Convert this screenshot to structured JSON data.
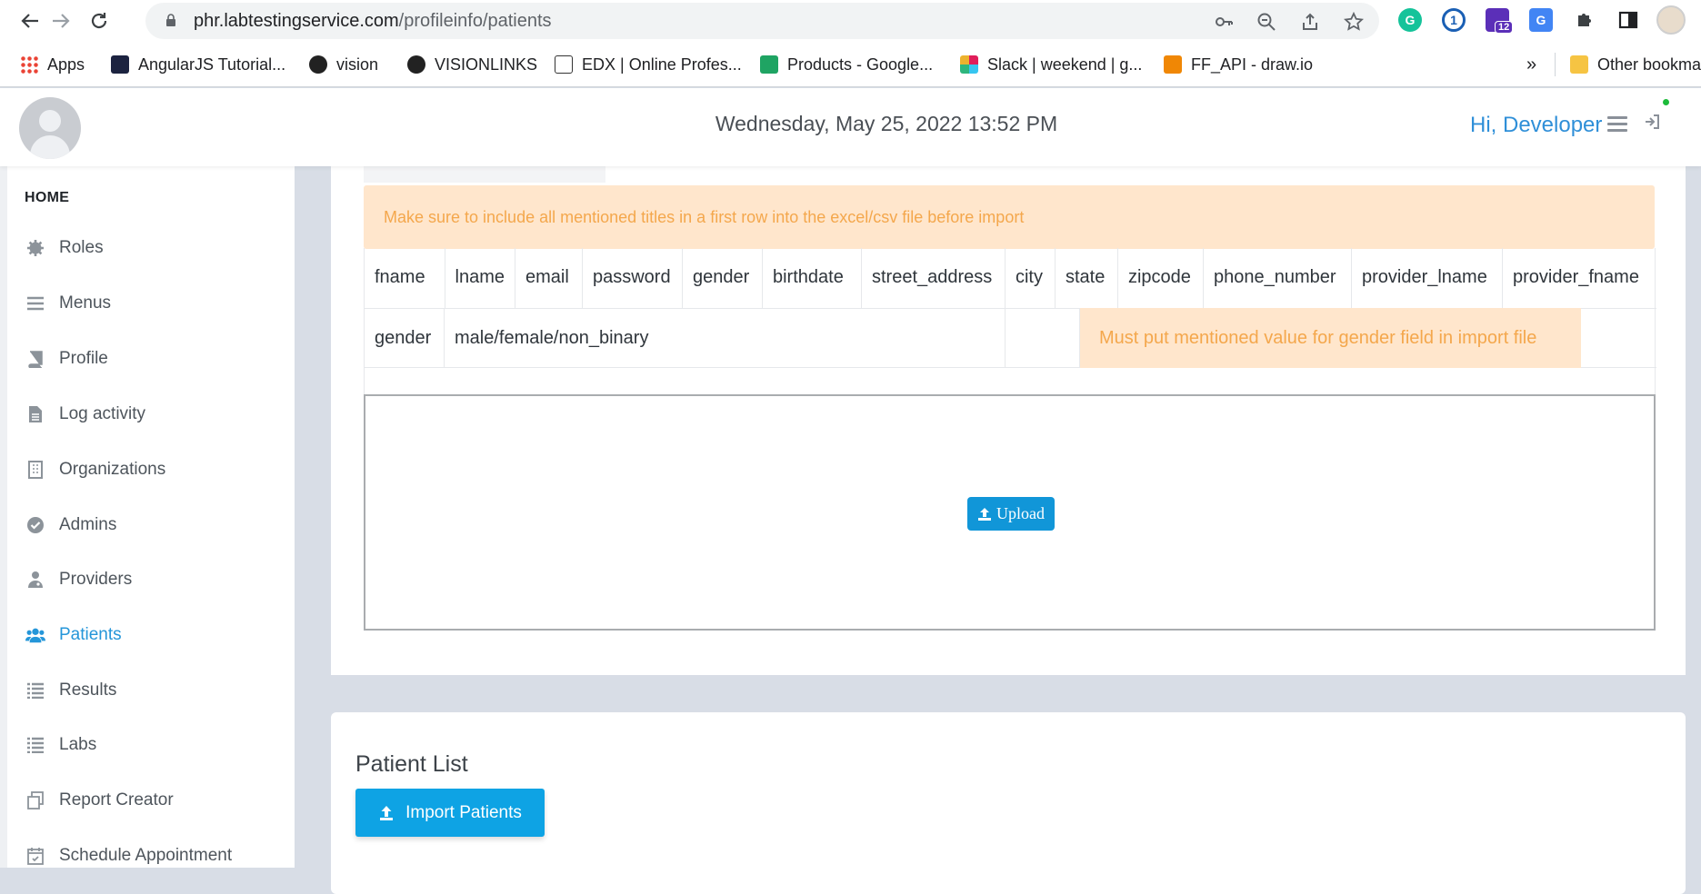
{
  "browser": {
    "url_host": "phr.labtestingservice.com",
    "url_path": "/profileinfo/patients",
    "extension_badge": "12",
    "bookmarks": [
      {
        "label": "Apps"
      },
      {
        "label": "AngularJS Tutorial..."
      },
      {
        "label": "vision"
      },
      {
        "label": "VISIONLINKS"
      },
      {
        "label": "EDX | Online Profes..."
      },
      {
        "label": "Products - Google..."
      },
      {
        "label": "Slack | weekend | g..."
      },
      {
        "label": "FF_API - draw.io"
      }
    ],
    "more_bookmarks": "»",
    "other_bookmarks": "Other bookmarks"
  },
  "header": {
    "datetime": "Wednesday, May 25, 2022 13:52 PM",
    "greeting": "Hi, Developer"
  },
  "sidebar": {
    "heading": "HOME",
    "items": [
      {
        "label": "Roles",
        "icon": "gear-icon"
      },
      {
        "label": "Menus",
        "icon": "menu-icon"
      },
      {
        "label": "Profile",
        "icon": "book-icon"
      },
      {
        "label": "Log activity",
        "icon": "file-icon"
      },
      {
        "label": "Organizations",
        "icon": "building-icon"
      },
      {
        "label": "Admins",
        "icon": "check-circle-icon"
      },
      {
        "label": "Providers",
        "icon": "doctor-icon"
      },
      {
        "label": "Patients",
        "icon": "users-icon",
        "active": true
      },
      {
        "label": "Results",
        "icon": "list-icon"
      },
      {
        "label": "Labs",
        "icon": "list-icon"
      },
      {
        "label": "Report Creator",
        "icon": "copy-icon"
      },
      {
        "label": "Schedule Appointment",
        "icon": "calendar-check-icon"
      }
    ]
  },
  "import": {
    "alert": "Make sure to include all mentioned titles in a first row into the excel/csv file before import",
    "columns": [
      "fname",
      "lname",
      "email",
      "password",
      "gender",
      "birthdate",
      "street_address",
      "city",
      "state",
      "zipcode",
      "phone_number",
      "provider_lname",
      "provider_fname"
    ],
    "gender_row": {
      "field": "gender",
      "values": "male/female/non_binary",
      "note": "Must put mentioned value for gender field in import file"
    },
    "upload_label": "Upload"
  },
  "patient_list": {
    "title": "Patient List",
    "import_button": "Import Patients"
  },
  "colors": {
    "accent": "#2596d9",
    "button": "#0ea3e4",
    "alert_bg": "#ffe6cc",
    "alert_text": "#f4a74c"
  }
}
